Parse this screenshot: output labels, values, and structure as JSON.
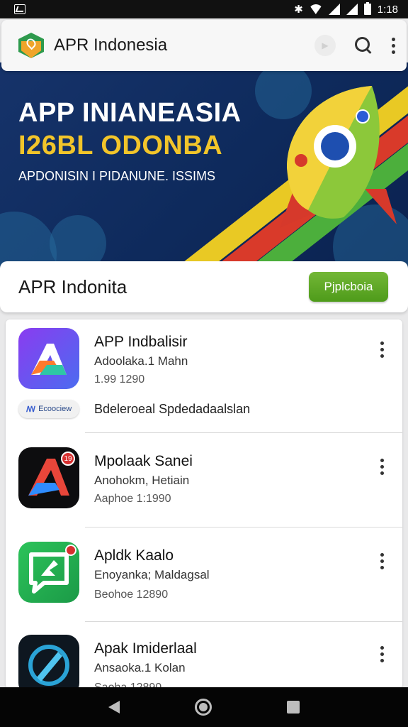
{
  "status_bar": {
    "time": "1:18",
    "icons": [
      "bluetooth-icon",
      "wifi-icon",
      "signal-icon",
      "signal-icon",
      "battery-icon"
    ]
  },
  "app_bar": {
    "title": "APR Indonesia",
    "icons": [
      "app-logo",
      "search-icon",
      "more-vert-icon"
    ]
  },
  "hero": {
    "line1": "APP INIANEASIA",
    "line2": "I26BL ODONBA",
    "subtitle": "APDONISIN I PIDANUNE. ISSIMS"
  },
  "featured": {
    "title": "APR Indonita",
    "button_label": "Pjplcboia"
  },
  "apps": [
    {
      "name": "APP Indbalisir",
      "developer": "Adoolaka.1 Mahn",
      "meta": "1.99 1290",
      "chip_label": "Ecoociew",
      "chip_description": "Bdeleroeal Spdedadaalslan"
    },
    {
      "name": "Mpolaak Sanei",
      "developer": "Anohokm, Hetiain",
      "meta": "Aaphoe 1:1990",
      "badge": "19"
    },
    {
      "name": "Apldk Kaalo",
      "developer": "Enoyanka; Maldagsal",
      "meta": "Beohoe 12890"
    },
    {
      "name": "Apak Imiderlaal",
      "developer": "Ansaoka.1 Kolan",
      "meta": "Saoha 12890"
    }
  ],
  "colors": {
    "accent_green": "#5aa624",
    "hero_blue": "#14306a",
    "hero_yellow": "#f2c52a"
  },
  "nav_bar": {
    "icons": [
      "back-icon",
      "home-icon",
      "recents-icon"
    ]
  }
}
